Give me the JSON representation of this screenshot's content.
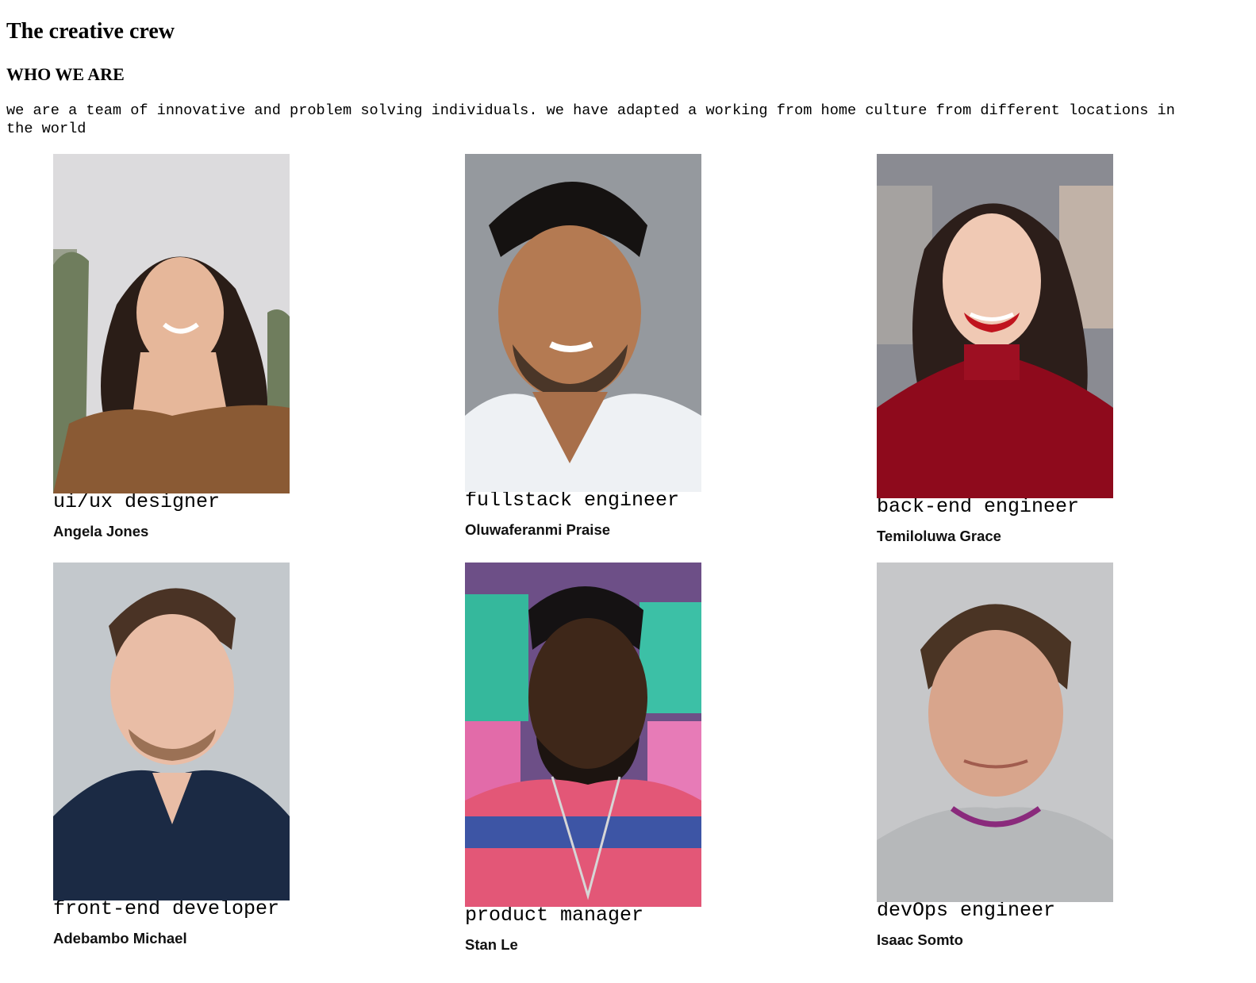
{
  "page": {
    "title": "The creative crew",
    "subtitle": "WHO WE ARE",
    "intro": "we are a team of innovative and problem solving individuals. we have adapted a working from home culture from different locations in the world"
  },
  "members": [
    {
      "role": "ui/ux designer",
      "name": "Angela Jones",
      "photo_icon": "portrait-photo"
    },
    {
      "role": "fullstack engineer",
      "name": "Oluwaferanmi Praise",
      "photo_icon": "portrait-photo"
    },
    {
      "role": "back-end engineer",
      "name": "Temiloluwa Grace",
      "photo_icon": "portrait-photo"
    },
    {
      "role": "front-end developer",
      "name": "Adebambo Michael",
      "photo_icon": "portrait-photo"
    },
    {
      "role": "product manager",
      "name": "Stan Le",
      "photo_icon": "portrait-photo"
    },
    {
      "role": "devOps engineer",
      "name": "Isaac Somto",
      "photo_icon": "portrait-photo"
    }
  ]
}
